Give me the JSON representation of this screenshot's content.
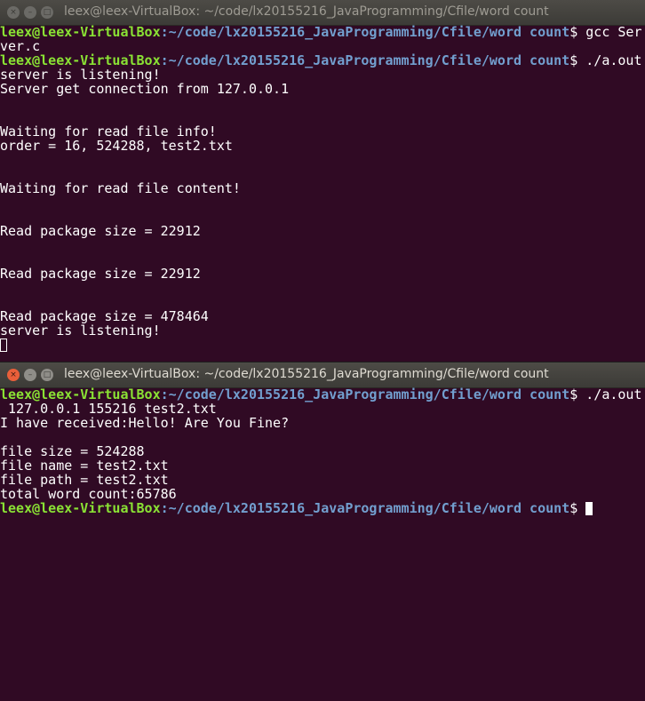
{
  "colors": {
    "background": "#300a24",
    "user": "#8ae234",
    "path": "#729fcf",
    "text": "#ffffff",
    "close_active": "#e95f3a"
  },
  "server_window": {
    "title": "leex@leex-VirtualBox: ~/code/lx20155216_JavaProgramming/Cfile/word count",
    "prompt_user": "leex@leex-VirtualBox",
    "prompt_path": ":~/code/lx20155216_JavaProgramming/Cfile/word count",
    "lines": [
      {
        "type": "prompt",
        "cmd": "$ gcc Ser"
      },
      {
        "type": "text",
        "text": "ver.c"
      },
      {
        "type": "prompt",
        "cmd": "$ ./a.out"
      },
      {
        "type": "text",
        "text": "server is listening!"
      },
      {
        "type": "text",
        "text": "Server get connection from 127.0.0.1"
      },
      {
        "type": "text",
        "text": ""
      },
      {
        "type": "text",
        "text": ""
      },
      {
        "type": "text",
        "text": "Waiting for read file info!"
      },
      {
        "type": "text",
        "text": "order = 16, 524288, test2.txt"
      },
      {
        "type": "text",
        "text": ""
      },
      {
        "type": "text",
        "text": ""
      },
      {
        "type": "text",
        "text": "Waiting for read file content!"
      },
      {
        "type": "text",
        "text": ""
      },
      {
        "type": "text",
        "text": ""
      },
      {
        "type": "text",
        "text": "Read package size = 22912"
      },
      {
        "type": "text",
        "text": ""
      },
      {
        "type": "text",
        "text": ""
      },
      {
        "type": "text",
        "text": "Read package size = 22912"
      },
      {
        "type": "text",
        "text": ""
      },
      {
        "type": "text",
        "text": ""
      },
      {
        "type": "text",
        "text": "Read package size = 478464"
      },
      {
        "type": "text",
        "text": "server is listening!"
      }
    ]
  },
  "client_window": {
    "title": "leex@leex-VirtualBox: ~/code/lx20155216_JavaProgramming/Cfile/word count",
    "prompt_user": "leex@leex-VirtualBox",
    "prompt_path": ":~/code/lx20155216_JavaProgramming/Cfile/word count",
    "lines": [
      {
        "type": "prompt",
        "cmd": "$ ./a.out"
      },
      {
        "type": "text",
        "text": " 127.0.0.1 155216 test2.txt"
      },
      {
        "type": "text",
        "text": "I have received:Hello! Are You Fine?"
      },
      {
        "type": "text",
        "text": ""
      },
      {
        "type": "text",
        "text": "file size = 524288"
      },
      {
        "type": "text",
        "text": "file name = test2.txt"
      },
      {
        "type": "text",
        "text": "file path = test2.txt"
      },
      {
        "type": "text",
        "text": "total word count:65786"
      }
    ],
    "final_prompt_cmd": "$ "
  },
  "window_buttons": {
    "close": "×",
    "minimize": "–",
    "maximize": "□"
  }
}
